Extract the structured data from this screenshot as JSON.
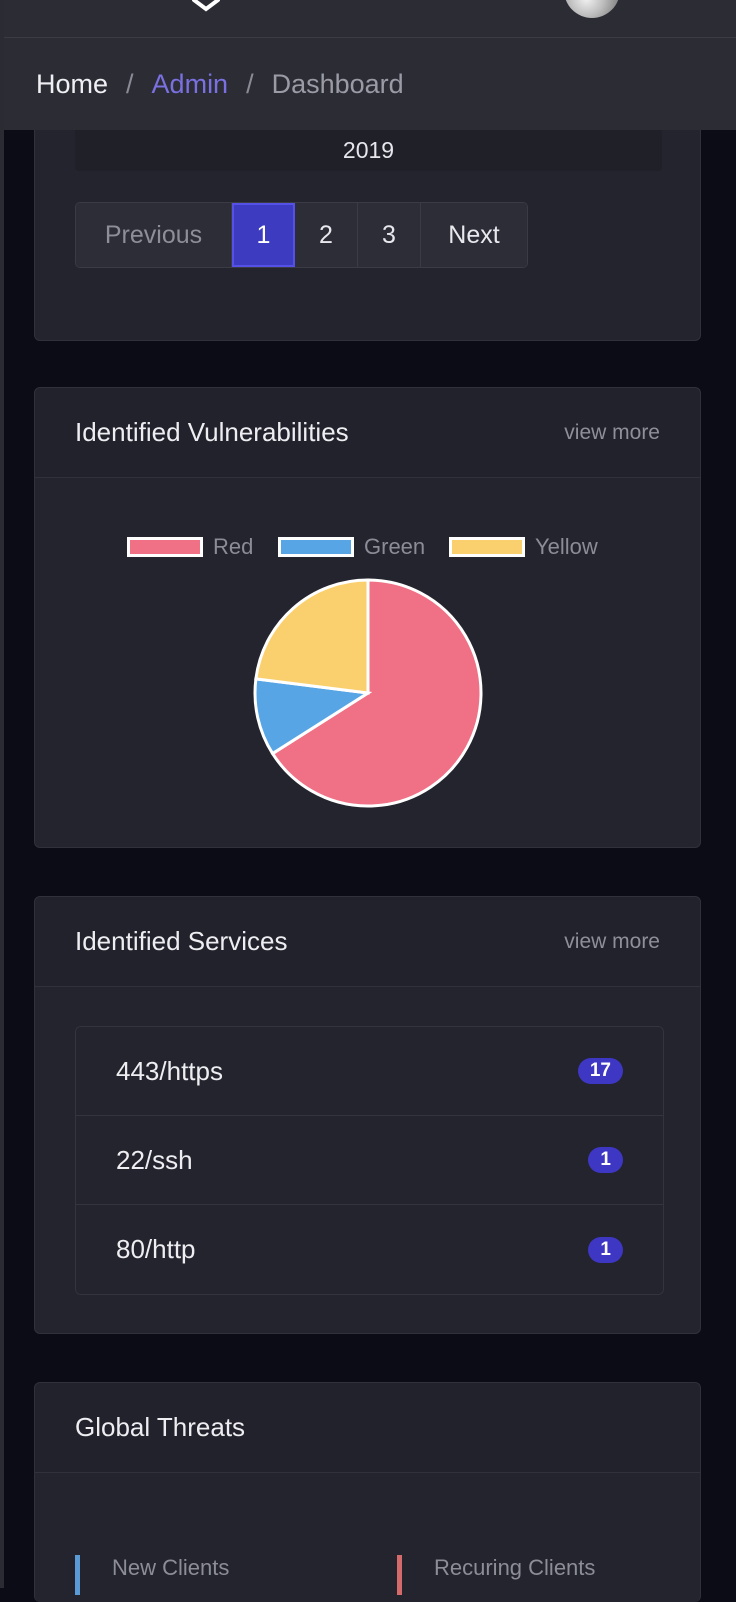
{
  "breadcrumb": {
    "home": "Home",
    "separator": "/",
    "admin": "Admin",
    "current": "Dashboard"
  },
  "top_card": {
    "year_text": "2019",
    "pagination": {
      "previous": "Previous",
      "pages": [
        "1",
        "2",
        "3"
      ],
      "active": "1",
      "next": "Next"
    }
  },
  "vulnerabilities": {
    "title": "Identified Vulnerabilities",
    "view_more": "view more",
    "chart_data": {
      "type": "pie",
      "labels": [
        "Red",
        "Green",
        "Yellow"
      ],
      "values": [
        66,
        11,
        23
      ],
      "colors": [
        "#f07085",
        "#58a5e5",
        "#fad06e"
      ],
      "legend_position": "top"
    }
  },
  "services": {
    "title": "Identified Services",
    "view_more": "view more",
    "items": [
      {
        "name": "443/https",
        "count": "17"
      },
      {
        "name": "22/ssh",
        "count": "1"
      },
      {
        "name": "80/http",
        "count": "1"
      }
    ]
  },
  "threats": {
    "title": "Global Threats",
    "stats": [
      {
        "label": "New Clients",
        "color": "#5b9bd5"
      },
      {
        "label": "Recuring Clients",
        "color": "#d46a6a"
      }
    ]
  }
}
